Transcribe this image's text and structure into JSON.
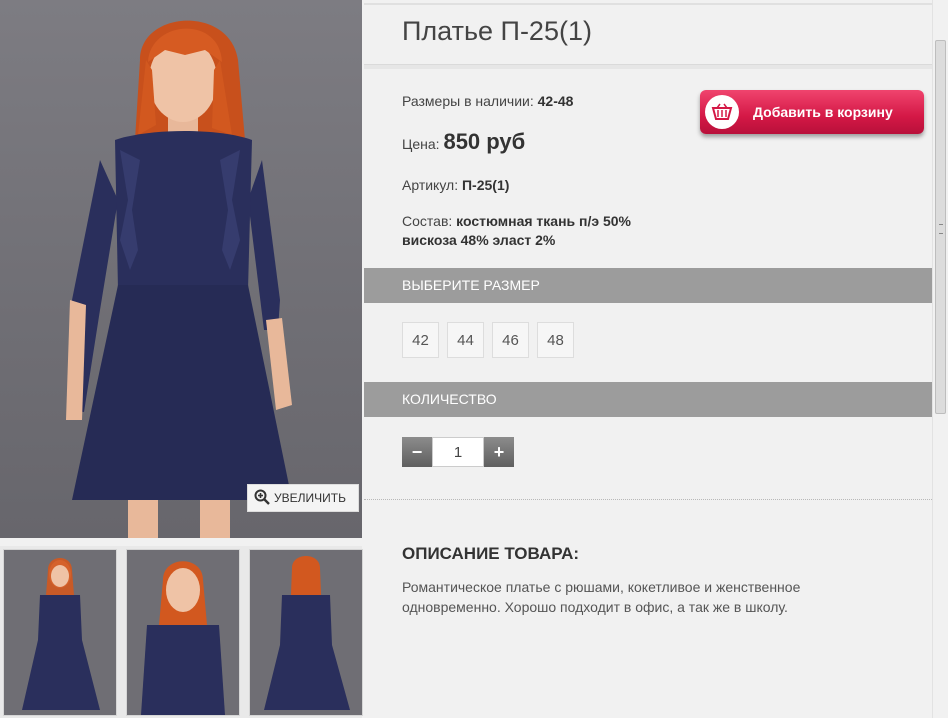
{
  "product": {
    "title": "Платье П-25(1)",
    "sizes_label": "Размеры в наличии:",
    "sizes_value": "42-48",
    "price_label": "Цена:",
    "price_value": "850 руб",
    "sku_label": "Артикул:",
    "sku_value": "П-25(1)",
    "composition_label": "Состав:",
    "composition_line1": "костюмная ткань п/э 50%",
    "composition_line2": "вискоза 48% эласт 2%"
  },
  "cart": {
    "button_label": "Добавить в корзину",
    "icon": "basket-icon"
  },
  "gallery": {
    "zoom_label": "УВЕЛИЧИТЬ",
    "zoom_icon": "magnifier-plus-icon"
  },
  "size_section": {
    "header": "ВЫБЕРИТЕ РАЗМЕР",
    "options": [
      "42",
      "44",
      "46",
      "48"
    ]
  },
  "quantity_section": {
    "header": "КОЛИЧЕСТВО",
    "minus": "−",
    "plus": "+",
    "value": "1"
  },
  "description": {
    "title": "ОПИСАНИЕ ТОВАРА:",
    "text": "Романтическое платье с рюшами, кокетливое и женственное одновременно. Хорошо подходит в офис, а так же в школу."
  },
  "colors": {
    "accent": "#d41846",
    "section_bar": "#9c9c9c",
    "dress": "#2a2f5c",
    "hair": "#d2581f"
  }
}
